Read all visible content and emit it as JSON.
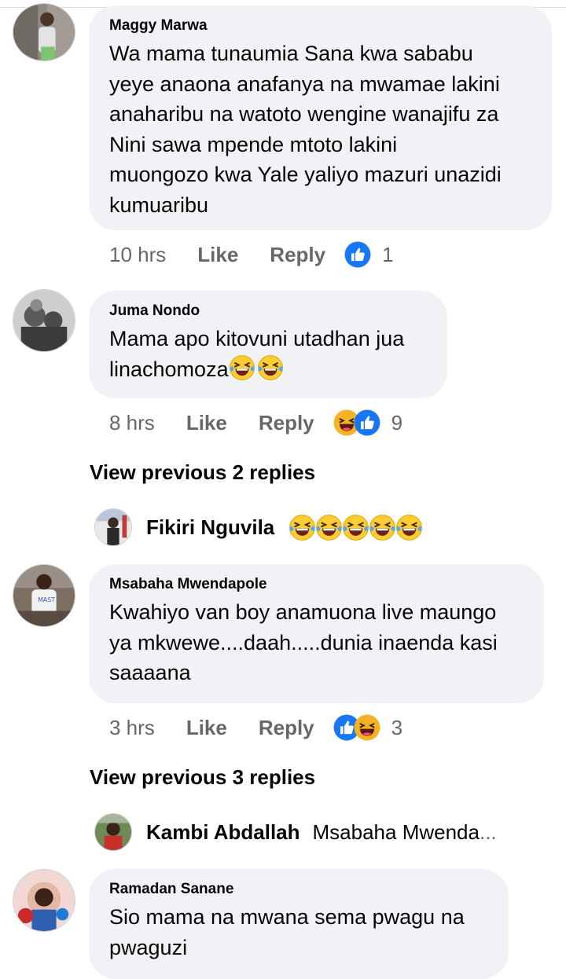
{
  "comments": [
    {
      "author": "Maggy Marwa",
      "lines": [
        "Wa mama tunaumia Sana kwa sababu",
        "yeye anaona anafanya na mwamae lakini",
        "anaharibu na watoto wengine wanajifu za",
        "Nini sawa mpende mtoto lakini",
        "muongozo kwa Yale yaliyo mazuri unazidi",
        "kumuaribu"
      ],
      "time": "10 hrs",
      "like": "Like",
      "reply": "Reply",
      "reaction_icons": [
        "like-icon"
      ],
      "reaction_count": "1"
    },
    {
      "author": "Juma Nondo",
      "lines": [
        "Mama apo kitovuni utadhan jua",
        "linachomoza"
      ],
      "trailing_emojis": [
        "laughing-tears-emoji",
        "laughing-tears-emoji"
      ],
      "time": "8 hrs",
      "like": "Like",
      "reply": "Reply",
      "reaction_icons": [
        "haha-icon",
        "like-icon"
      ],
      "reaction_count": "9"
    },
    {
      "author": "Msabaha Mwendapole",
      "lines": [
        "Kwahiyo van boy anamuona live maungo",
        "ya mkwewe....daah.....dunia inaenda kasi",
        "saaaana"
      ],
      "time": "3 hrs",
      "like": "Like",
      "reply": "Reply",
      "reaction_icons": [
        "like-icon",
        "haha-icon"
      ],
      "reaction_count": "3"
    },
    {
      "author": "Ramadan Sanane",
      "lines": [
        "Sio mama na mwana sema pwagu na",
        "pwaguzi"
      ]
    }
  ],
  "view_previous": [
    "View previous 2 replies",
    "View previous 3 replies"
  ],
  "reply_previews": [
    {
      "name": "Fikiri Nguvila",
      "emojis": [
        "laughing-tears-emoji",
        "laughing-tears-emoji",
        "laughing-tears-emoji",
        "laughing-tears-emoji",
        "laughing-tears-emoji"
      ]
    },
    {
      "name": "Kambi Abdallah",
      "snippet": "Msabaha Mwenda",
      "ellipsis": "..."
    }
  ],
  "colors": {
    "bubble": "#f0f2f5",
    "secondary_text": "#65676b",
    "like_blue": "#1877f2",
    "haha_yellow": "#f7b125"
  }
}
